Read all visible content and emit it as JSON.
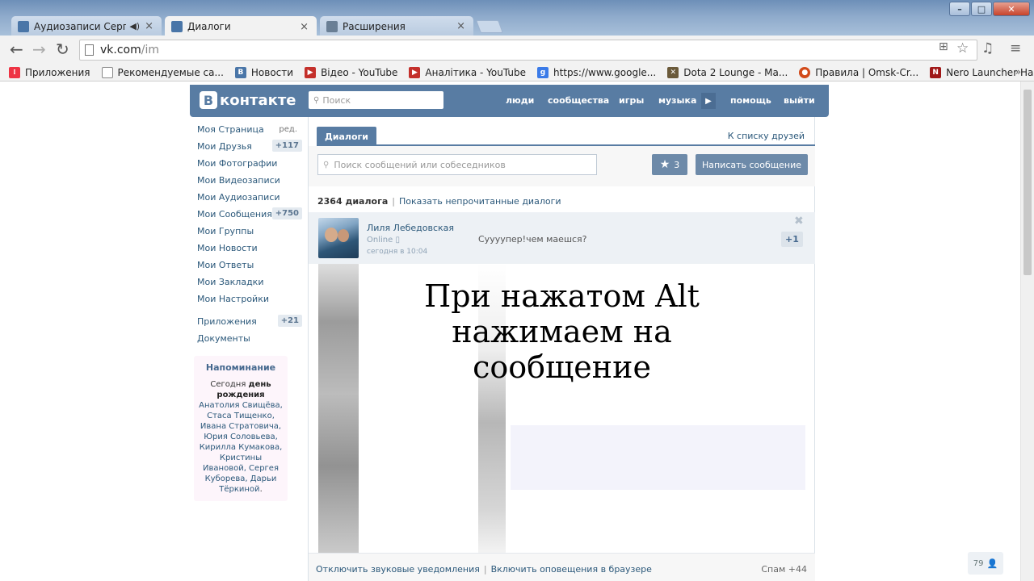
{
  "browser": {
    "tabs": [
      {
        "label": "Аудиозаписи Сергея",
        "active": false
      },
      {
        "label": "Диалоги",
        "active": true
      },
      {
        "label": "Расширения",
        "active": false
      }
    ],
    "url_host": "vk.com",
    "url_path": "/im",
    "bookmarks": [
      {
        "label": "Приложения",
        "icon": "apps-grid-icon"
      },
      {
        "label": "Рекомендуемые са...",
        "icon": "page-icon"
      },
      {
        "label": "Новости",
        "icon": "vk-icon"
      },
      {
        "label": "Відео - YouTube",
        "icon": "youtube-icon"
      },
      {
        "label": "Аналітика - YouTube",
        "icon": "youtube-icon"
      },
      {
        "label": "https://www.google...",
        "icon": "google-icon"
      },
      {
        "label": "Dota 2 Lounge - Ма...",
        "icon": "dota-icon"
      },
      {
        "label": "Правила | Omsk-Cr...",
        "icon": "omsk-icon"
      },
      {
        "label": "Nero Launcher Hack",
        "icon": "nero-icon"
      }
    ],
    "bookmarks_more": "»"
  },
  "vk": {
    "logo": "контакте",
    "logo_letter": "В",
    "search_placeholder": "Поиск",
    "nav": {
      "people": "люди",
      "communities": "сообщества",
      "games": "игры",
      "music": "музыка",
      "help": "помощь",
      "logout": "выйти"
    },
    "menu": [
      {
        "label": "Моя Страница",
        "edit": "ред."
      },
      {
        "label": "Мои Друзья",
        "count": "+117"
      },
      {
        "label": "Мои Фотографии"
      },
      {
        "label": "Мои Видеозаписи"
      },
      {
        "label": "Мои Аудиозаписи"
      },
      {
        "label": "Мои Сообщения",
        "count": "+750"
      },
      {
        "label": "Мои Группы"
      },
      {
        "label": "Мои Новости"
      },
      {
        "label": "Мои Ответы"
      },
      {
        "label": "Мои Закладки"
      },
      {
        "label": "Мои Настройки"
      },
      {
        "label": "Приложения",
        "count": "+21"
      },
      {
        "label": "Документы"
      }
    ],
    "reminder": {
      "title": "Напоминание",
      "prefix": "Сегодня ",
      "bold": "день рождения",
      "names": " Анатолия Свищёва, Стаса Тищенко, Ивана Стратовича, Юрия Соловьева, Кирилла Кумакова, Кристины Ивановой, Сергея Куборева, Дарьи Тёркиной",
      "suffix": "."
    },
    "dialogs": {
      "tab": "Диалоги",
      "friends_link": "К списку друзей",
      "search_placeholder": "Поиск сообщений или собеседников",
      "starred_count": "3",
      "write_button": "Написать сообщение",
      "count_text": "2364 диалога",
      "show_unread": "Показать непрочитанные диалоги",
      "rows": [
        {
          "name": "Лиля Лебедовская",
          "status": "Online",
          "time": "сегодня в 10:04",
          "message": "Суууупер!чем маешся?",
          "unread": "+1"
        }
      ],
      "overlay_lines": [
        "При нажатом Alt",
        "нажимаем на",
        "сообщение"
      ],
      "footer_sound": "Отключить звуковые уведомления",
      "footer_browser": "Включить оповещения в браузере",
      "footer_spam": "Спам +44"
    },
    "online_count": "79"
  },
  "colors": {
    "vk_blue": "#587ca3",
    "link": "#2b587a",
    "button": "#6d8aa9"
  }
}
